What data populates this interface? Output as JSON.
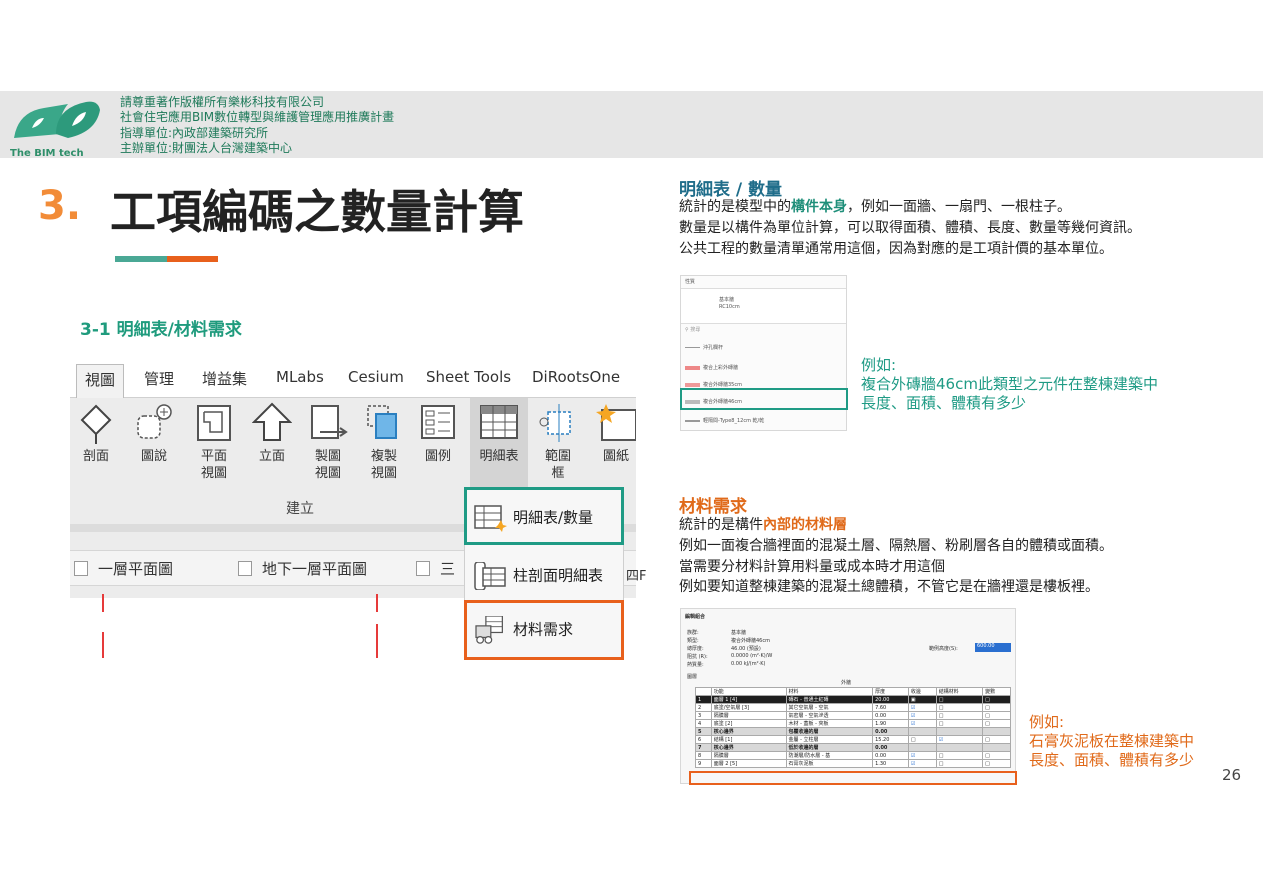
{
  "header": {
    "logo_text": "The BIM tech",
    "lines": [
      "請尊重著作版權所有樂彬科技有限公司",
      "社會住宅應用BIM數位轉型與維護管理應用推廣計畫",
      "指導單位:內政部建築研究所",
      "主辦單位:財團法人台灣建築中心"
    ]
  },
  "title": {
    "number": "3.",
    "text": "工項編碼之數量計算"
  },
  "subtitle": "3-1 明細表/材料需求",
  "ribbon": {
    "tabs": [
      "視圖",
      "管理",
      "增益集",
      "MLabs",
      "Cesium",
      "Sheet Tools",
      "DiRootsOne"
    ],
    "tools": [
      {
        "label": "剖面",
        "icon": "section-icon"
      },
      {
        "label": "圖說",
        "icon": "callout-icon"
      },
      {
        "label": "平面\n視圖",
        "icon": "plan-view-icon"
      },
      {
        "label": "立面",
        "icon": "elevation-icon"
      },
      {
        "label": "製圖\n視圖",
        "icon": "drafting-view-icon"
      },
      {
        "label": "複製\n視圖",
        "icon": "duplicate-view-icon"
      },
      {
        "label": "圖例",
        "icon": "legend-icon"
      },
      {
        "label": "明細表",
        "icon": "schedule-icon"
      },
      {
        "label": "範圍\n框",
        "icon": "scope-box-icon"
      },
      {
        "label": "圖紙",
        "icon": "sheet-icon"
      }
    ],
    "group_label": "建立",
    "view_tabs": [
      "一層平面圖",
      "地下一層平面圖",
      "三"
    ]
  },
  "dropdown": {
    "items": [
      "明細表/數量",
      "柱剖面明細表",
      "材料需求"
    ],
    "partial_text": "四F"
  },
  "section1": {
    "heading": "明細表 / 數量",
    "line1_pre": "統計的是模型中的",
    "line1_hl": "構件本身",
    "line1_post": "，例如一面牆、一扇門、一根柱子。",
    "line2": "數量是以構件為單位計算，可以取得面積、體積、長度、數量等幾何資訊。",
    "line3": "公共工程的數量清單通常用這個，因為對應的是工項計價的基本單位。",
    "note_label": "例如:",
    "note_line1": "複合外磚牆46cm此類型之元件在整棟建築中",
    "note_line2": "長度、面積、體積有多少",
    "screenshot": {
      "header": "性質",
      "family": "基本牆",
      "type": "RC10cm",
      "search": "搜尋",
      "items": [
        "沖孔欄杆",
        "複合上彩外磚牆",
        "複合外磚牆35cm",
        "複合外磚牆46cm",
        "輕隔間-Type8_12cm 乾/乾"
      ]
    }
  },
  "section2": {
    "heading": "材料需求",
    "line1_pre": "統計的是構件",
    "line1_hl": "內部的材料層",
    "line2": "例如一面複合牆裡面的混凝土層、隔熱層、粉刷層各自的體積或面積。",
    "line3": "當需要分材料計算用料量或成本時才用這個",
    "line4": "例如要知道整棟建築的混凝土總體積，不管它是在牆裡還是樓板裡。",
    "note_label": "例如:",
    "note_line1": "石膏灰泥板在整棟建築中",
    "note_line2": "長度、面積、體積有多少",
    "screenshot": {
      "title": "編輯組合",
      "fields": [
        {
          "k": "族群:",
          "v": "基本牆"
        },
        {
          "k": "類型:",
          "v": "複合外磚牆46cm"
        },
        {
          "k": "總厚度:",
          "v": "46.00 (預設)"
        },
        {
          "k": "阻抗 (R):",
          "v": "0.0000 (m²·K)/W"
        },
        {
          "k": "熱質量:",
          "v": "0.00 kJ/(m²·K)"
        }
      ],
      "sample_label": "範例高度(S):",
      "sample_value": "600.00",
      "layers_label": "圖層",
      "exterior_label": "外牆",
      "columns": [
        "",
        "功能",
        "材料",
        "厚度",
        "收邊",
        "結構材料",
        "變數"
      ],
      "rows": [
        [
          "1",
          "面層 1 [4]",
          "磚石 - 普通土紅磚",
          "20.00"
        ],
        [
          "2",
          "底塗/空氣層 [3]",
          "其它空氣層 - 空氣",
          "7.60"
        ],
        [
          "3",
          "隔膜層",
          "氣密層 - 空氣滲透",
          "0.00"
        ],
        [
          "4",
          "底塗 [2]",
          "木材 - 蓋板 - 夾板",
          "1.90"
        ],
        [
          "5",
          "核心邊界",
          "包覆收邊的層",
          "0.00"
        ],
        [
          "6",
          "結構 [1]",
          "金屬 - 立柱層",
          "15.20"
        ],
        [
          "7",
          "核心邊界",
          "低於收邊的層",
          "0.00"
        ],
        [
          "8",
          "隔膜層",
          "防潮層/防水層 - 基",
          "0.00"
        ],
        [
          "9",
          "面層 2 [5]",
          "石膏灰泥板",
          "1.30"
        ]
      ]
    }
  },
  "page_number": "26",
  "colors": {
    "teal": "#1f9b85",
    "orange": "#e8601c",
    "title_number": "#f28c38"
  }
}
